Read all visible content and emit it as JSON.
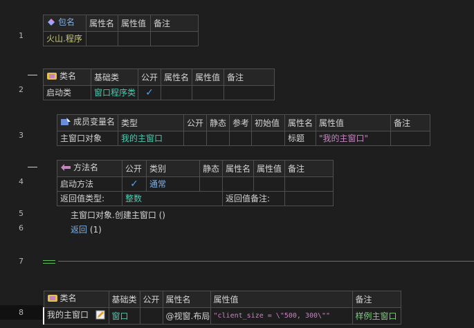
{
  "line_numbers": [
    "1",
    "2",
    "3",
    "4",
    "5",
    "6",
    "7",
    "8"
  ],
  "package_table": {
    "headers": [
      "包名",
      "属性名",
      "属性值",
      "备注"
    ],
    "row": [
      "火山.程序",
      "",
      "",
      ""
    ]
  },
  "class_table": {
    "headers": [
      "类名",
      "基础类",
      "公开",
      "属性名",
      "属性值",
      "备注"
    ],
    "row": {
      "name": "启动类",
      "base": "窗口程序类",
      "public": "✓",
      "prop_name": "",
      "prop_value": "",
      "remark": ""
    }
  },
  "member_table": {
    "headers": [
      "成员变量名",
      "类型",
      "公开",
      "静态",
      "参考",
      "初始值",
      "属性名",
      "属性值",
      "备注"
    ],
    "row": {
      "name": "主窗口对象",
      "type": "我的主窗口",
      "public": "",
      "static": "",
      "ref": "",
      "init": "",
      "prop_name": "标题",
      "prop_value": "\"我的主窗口\"",
      "remark": ""
    }
  },
  "method_table": {
    "headers": [
      "方法名",
      "公开",
      "类别",
      "静态",
      "属性名",
      "属性值",
      "备注"
    ],
    "row": {
      "name": "启动方法",
      "public": "✓",
      "category": "通常",
      "static": "",
      "prop_name": "",
      "prop_value": "",
      "remark": ""
    },
    "return_type_label": "返回值类型:",
    "return_type_value": "整数",
    "return_remark_label": "返回值备注:"
  },
  "code": {
    "line5": "主窗口对象.创建主窗口 ()",
    "line6_keyword": "返回",
    "line6_arg": " (1)"
  },
  "window_class_table": {
    "headers": [
      "类名",
      "基础类",
      "公开",
      "属性名",
      "属性值",
      "备注"
    ],
    "row": {
      "name": "我的主窗口",
      "base": "窗口",
      "public": "",
      "prop_name": "@视窗.布局",
      "prop_value": "\"client_size = \\\"500, 300\\\"\"",
      "remark": "样例主窗口"
    }
  },
  "colors": {
    "background": "#1e1e1e",
    "grid": "#4f4f4f",
    "keyword_blue": "#7fb1e6",
    "type_green": "#4ec9b0",
    "string_pink": "#c586c0",
    "remark_green": "#7ccf7c",
    "separator_green": "#3f8f3f"
  },
  "icons": [
    "package-icon",
    "class-icon",
    "member-variable-icon",
    "method-icon",
    "edit-icon",
    "check-icon"
  ]
}
